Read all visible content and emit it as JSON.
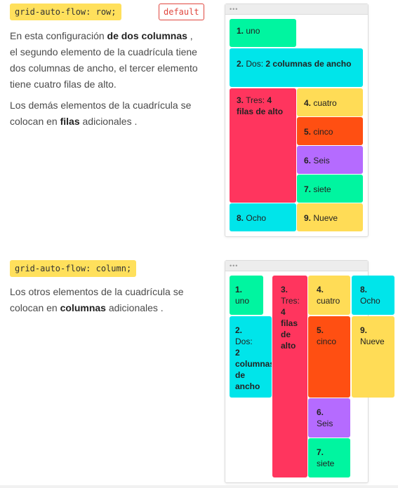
{
  "section_row": {
    "code": "grid-auto-flow: row;",
    "badge": "default",
    "p1_pre": "En esta configuración ",
    "p1_bold": "de dos columnas",
    "p1_post": " , el segundo elemento de la cuadrícula tiene dos columnas de ancho, el tercer elemento tiene cuatro filas de alto.",
    "p2_pre": "Los demás elementos de la cuadrícula se colocan en ",
    "p2_bold": "filas",
    "p2_post": " adicionales ."
  },
  "section_column": {
    "code": "grid-auto-flow: column;",
    "p1_pre": "Los otros elementos de la cuadrícula se colocan en ",
    "p1_bold": "columnas",
    "p1_post": " adicionales ."
  },
  "window_dots": "•••",
  "items": {
    "i1": {
      "num": "1.",
      "text": "uno",
      "extra": ""
    },
    "i2": {
      "num": "2.",
      "text": "Dos:",
      "extra": "2 columnas de ancho"
    },
    "i3": {
      "num": "3.",
      "text": "Tres:",
      "extra": "4 filas de alto"
    },
    "i4": {
      "num": "4.",
      "text": "cuatro"
    },
    "i5": {
      "num": "5.",
      "text": "cinco"
    },
    "i6": {
      "num": "6.",
      "text": "Seis"
    },
    "i7": {
      "num": "7.",
      "text": "siete"
    },
    "i8": {
      "num": "8.",
      "text": "Ocho"
    },
    "i9": {
      "num": "9.",
      "text": "Nueve"
    }
  },
  "colors": {
    "green": "#00f5a0",
    "cyan": "#00e5ea",
    "red": "#ff355e",
    "yellow": "#ffdc56",
    "orange": "#ff4f12",
    "purple": "#b56bff",
    "code_bg": "#ffe05c",
    "badge": "#e0473f"
  }
}
